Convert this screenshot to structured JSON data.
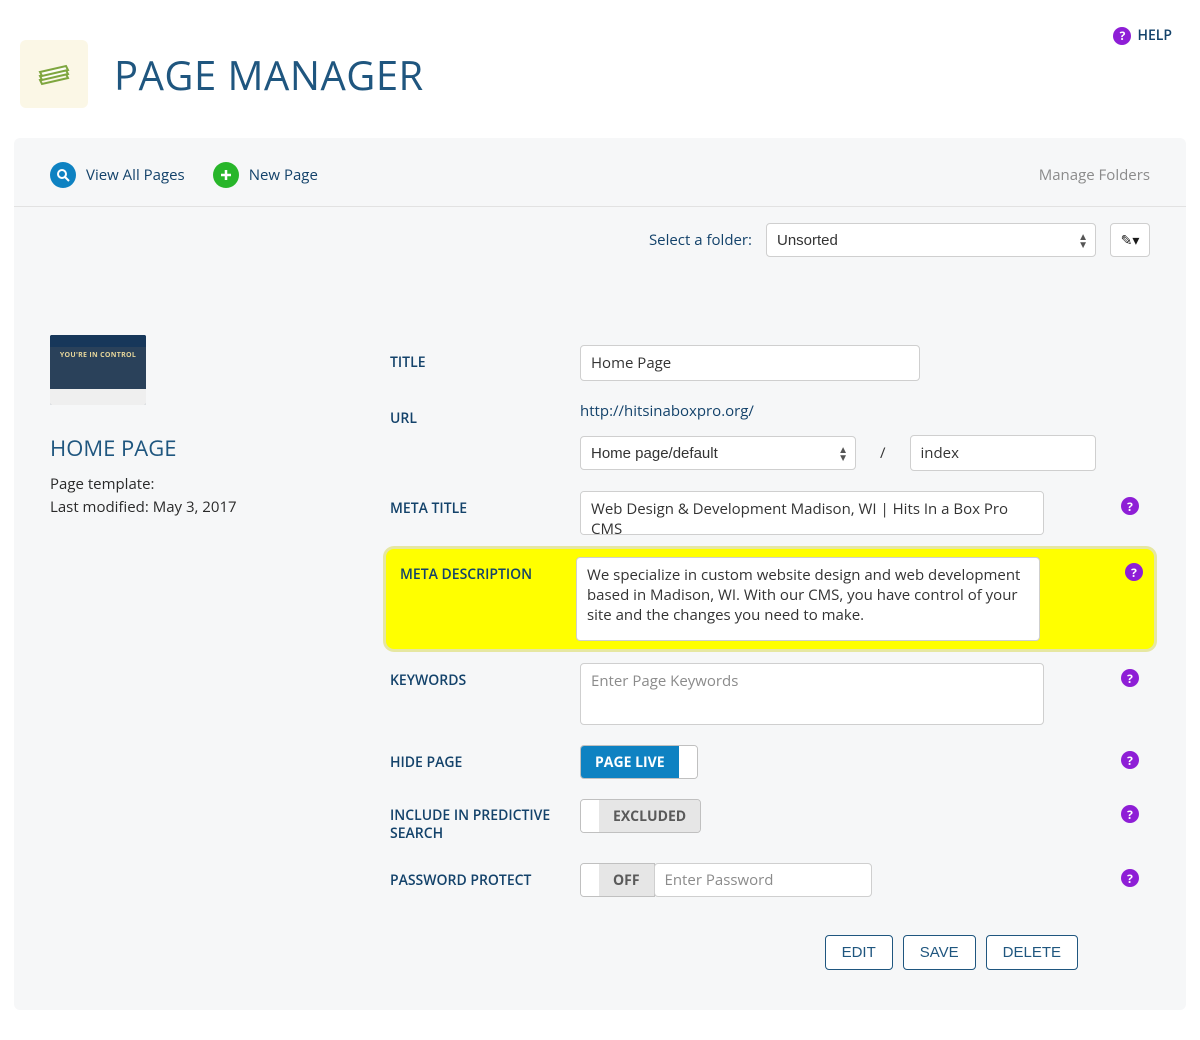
{
  "help": {
    "label": "HELP"
  },
  "header": {
    "title": "PAGE MANAGER"
  },
  "toolbar": {
    "view_all": "View All Pages",
    "new_page": "New Page",
    "manage_folders": "Manage Folders"
  },
  "folder": {
    "label": "Select a folder:",
    "selected": "Unsorted"
  },
  "sidebar": {
    "page_name": "HOME PAGE",
    "template_label": "Page template:",
    "modified_label": "Last modified: May 3, 2017",
    "thumb_hero": "YOU'RE IN CONTROL"
  },
  "form": {
    "title": {
      "label": "TITLE",
      "value": "Home Page"
    },
    "url": {
      "label": "URL",
      "base": "http://hitsinaboxpro.org/",
      "path_selected": "Home page/default",
      "slash": "/",
      "file": "index"
    },
    "meta_title": {
      "label": "META TITLE",
      "value": "Web Design & Development Madison, WI | Hits In a Box Pro CMS"
    },
    "meta_desc": {
      "label": "META DESCRIPTION",
      "value": "We specialize in custom website design and web development based in Madison, WI. With our CMS, you have control of your site and the changes you need to make."
    },
    "keywords": {
      "label": "KEYWORDS",
      "placeholder": "Enter Page Keywords"
    },
    "hide": {
      "label": "HIDE PAGE",
      "state": "PAGE LIVE"
    },
    "search": {
      "label": "INCLUDE IN PREDICTIVE SEARCH",
      "state": "EXCLUDED"
    },
    "password": {
      "label": "PASSWORD PROTECT",
      "state": "OFF",
      "placeholder": "Enter Password"
    }
  },
  "footer": {
    "edit": "EDIT",
    "save": "SAVE",
    "delete": "DELETE"
  }
}
